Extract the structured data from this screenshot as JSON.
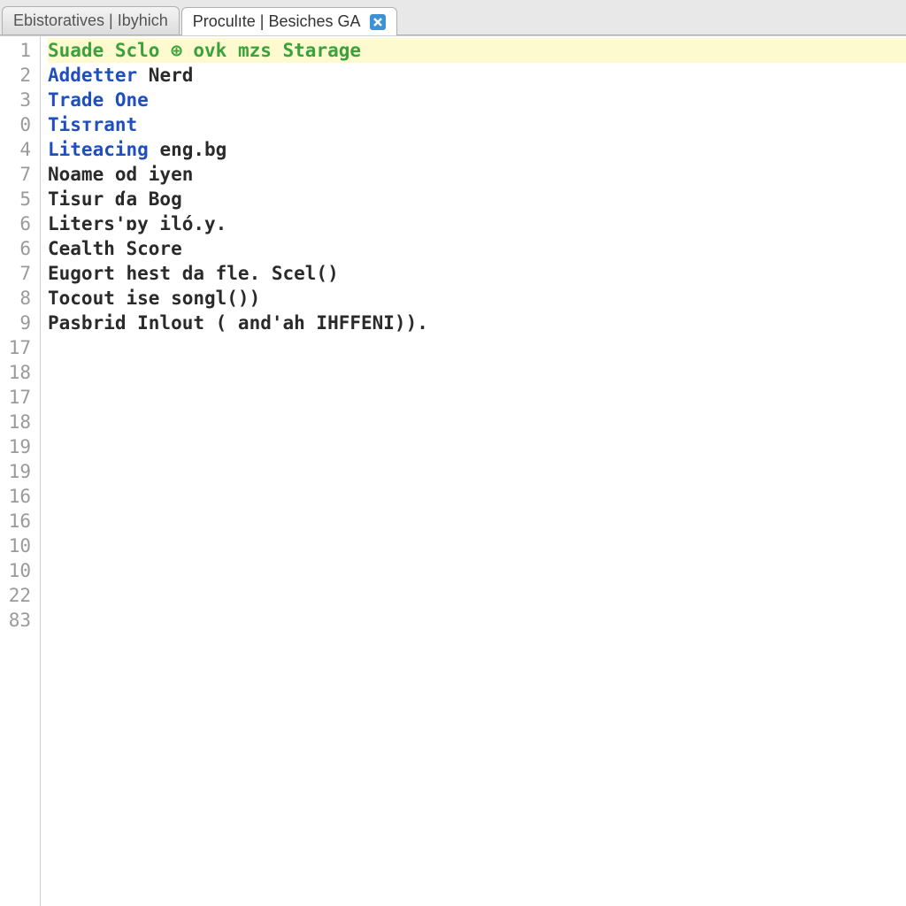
{
  "tabs": {
    "inactive": "Ebistoratives | Ibyhich",
    "active": "Proculıte | Besiches GA"
  },
  "line_numbers": [
    "1",
    "2",
    "3",
    "0",
    "4",
    "7",
    "5",
    "6",
    "6",
    "7",
    "8",
    "9",
    "17",
    "18",
    "17",
    "18",
    "19",
    "19",
    "16",
    "16",
    "10",
    "10",
    "22",
    "83"
  ],
  "lines": {
    "l0_a": "Suade Sclo ",
    "l0_b": "⊕",
    "l0_c": " ovk mzs Starage",
    "l1_a": "Addetter",
    "l1_b": " Nerd",
    "l2": "",
    "l3": "Trade One",
    "l4": "Tisтrant",
    "l5_a": "Liteacing",
    "l5_b": " eng.bg",
    "l6": "",
    "l7": "",
    "l8": "Noame od iyen",
    "l9": "",
    "l10": "Tisur ɗa Bog",
    "l11": "",
    "l12": "Liters'ɒy ilό.y.",
    "l13": "",
    "l14": "Cealth Score",
    "l15": "",
    "l16": "Eugort hest da fle. Scel()",
    "l17": "",
    "l18": "Tocout ise songl())",
    "l19": "",
    "l20": "Pasbrid Inlout ( and'ah IHFFENI)).",
    "l21": "",
    "l22": "",
    "l23": ""
  }
}
